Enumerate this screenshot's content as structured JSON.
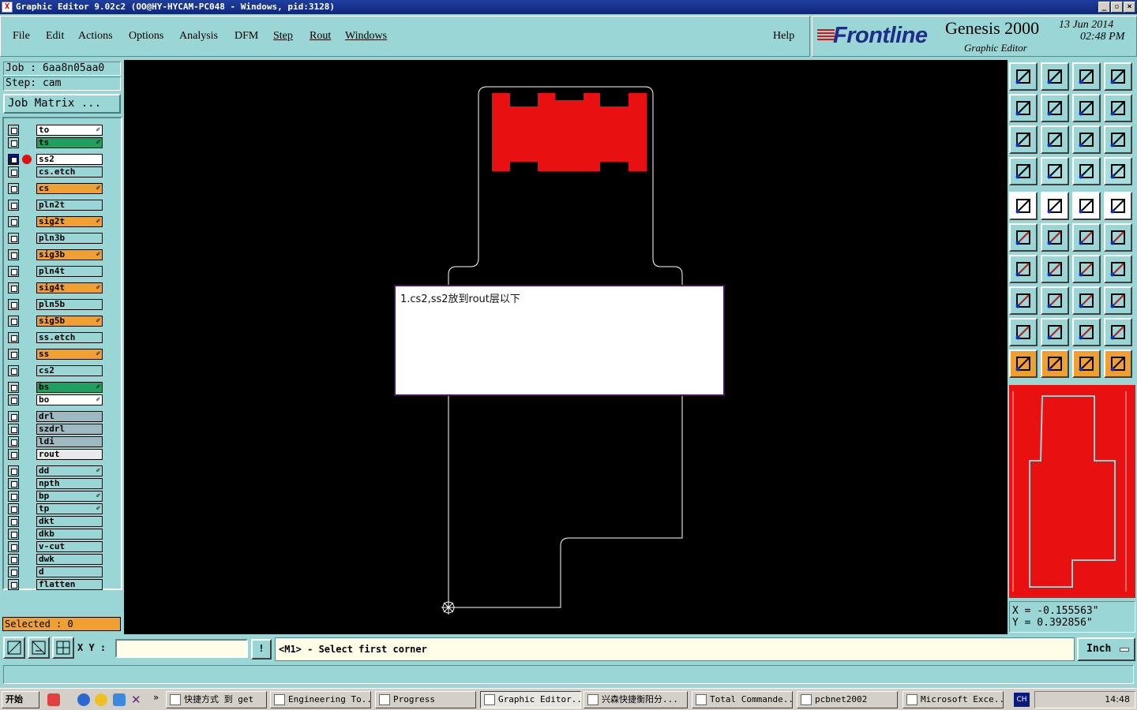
{
  "window": {
    "title": "Graphic Editor 9.02c2  (OO@HY-HYCAM-PC048 - Windows, pid:3128)"
  },
  "menu": {
    "items": [
      "File",
      "Edit",
      "Actions",
      "Options",
      "Analysis",
      "DFM",
      "Step",
      "Rout",
      "Windows"
    ],
    "help": "Help"
  },
  "brand": {
    "logo": "Frontline",
    "product": "Genesis 2000",
    "subtitle": "Graphic Editor",
    "date": "13  Jun  2014",
    "time": "02:48  PM"
  },
  "job": {
    "job_label": "Job  :  6aa8n05aa0",
    "step_label": "Step:  cam",
    "matrix_button": "Job Matrix ..."
  },
  "layers": [
    {
      "name": "to",
      "color": "#ffffff",
      "affected": true
    },
    {
      "name": "ts",
      "color": "#20a060",
      "affected": true
    },
    {
      "name": "ss2",
      "color": "#ffffff",
      "affected": false,
      "active": true,
      "work": true
    },
    {
      "name": "cs.etch",
      "color": "#9ad6d6",
      "affected": false
    },
    {
      "name": "cs",
      "color": "#f0a030",
      "affected": true
    },
    {
      "name": "pln2t",
      "color": "#9ad6d6",
      "affected": false
    },
    {
      "name": "sig2t",
      "color": "#f0a030",
      "affected": true
    },
    {
      "name": "pln3b",
      "color": "#9ad6d6",
      "affected": false
    },
    {
      "name": "sig3b",
      "color": "#f0a030",
      "affected": true
    },
    {
      "name": "pln4t",
      "color": "#9ad6d6",
      "affected": false
    },
    {
      "name": "sig4t",
      "color": "#f0a030",
      "affected": true
    },
    {
      "name": "pln5b",
      "color": "#9ad6d6",
      "affected": false
    },
    {
      "name": "sig5b",
      "color": "#f0a030",
      "affected": true
    },
    {
      "name": "ss.etch",
      "color": "#9ad6d6",
      "affected": false
    },
    {
      "name": "ss",
      "color": "#f0a030",
      "affected": true
    },
    {
      "name": "cs2",
      "color": "#9ad6d6",
      "affected": false
    },
    {
      "name": "bs",
      "color": "#20a060",
      "affected": true
    },
    {
      "name": "bo",
      "color": "#ffffff",
      "affected": true
    },
    {
      "name": "drl",
      "color": "#a0b8c0",
      "affected": false
    },
    {
      "name": "szdrl",
      "color": "#a0b8c0",
      "affected": false
    },
    {
      "name": "ldi",
      "color": "#a0b8c0",
      "affected": false
    },
    {
      "name": "rout",
      "color": "#e8e8e8",
      "affected": false
    },
    {
      "name": "dd",
      "color": "#9ad6d6",
      "affected": true
    },
    {
      "name": "npth",
      "color": "#9ad6d6",
      "affected": false
    },
    {
      "name": "bp",
      "color": "#9ad6d6",
      "affected": true
    },
    {
      "name": "tp",
      "color": "#9ad6d6",
      "affected": true
    },
    {
      "name": "dkt",
      "color": "#9ad6d6",
      "affected": false
    },
    {
      "name": "dkb",
      "color": "#9ad6d6",
      "affected": false
    },
    {
      "name": "v-cut",
      "color": "#9ad6d6",
      "affected": false
    },
    {
      "name": "dwk",
      "color": "#9ad6d6",
      "affected": false
    },
    {
      "name": "d",
      "color": "#9ad6d6",
      "affected": false
    },
    {
      "name": "flatten",
      "color": "#9ad6d6",
      "affected": false
    }
  ],
  "selected": "Selected : 0",
  "note": {
    "text": "1.cs2,ss2放到rout层以下"
  },
  "coords": {
    "x": "X  =  -0.155563\"",
    "y": "Y  =  0.392856\""
  },
  "command": {
    "xy_label": "X Y :",
    "xy_value": "",
    "excl": "!",
    "prompt": "<M1> - Select first corner",
    "units": "Inch"
  },
  "taskbar": {
    "start": "开始",
    "tasks": [
      "快捷方式 到 get",
      "Engineering To...",
      "Progress",
      "Graphic Editor...",
      "兴森快捷衡阳分...",
      "Total Commande...",
      "pcbnet2002",
      "Microsoft Exce..."
    ],
    "lang": "CH",
    "clock": "14:48"
  },
  "colors": {
    "panel": "#9ad6d6",
    "accent_orange": "#f0a030",
    "feature_red": "#e81010",
    "canvas": "#000000"
  }
}
